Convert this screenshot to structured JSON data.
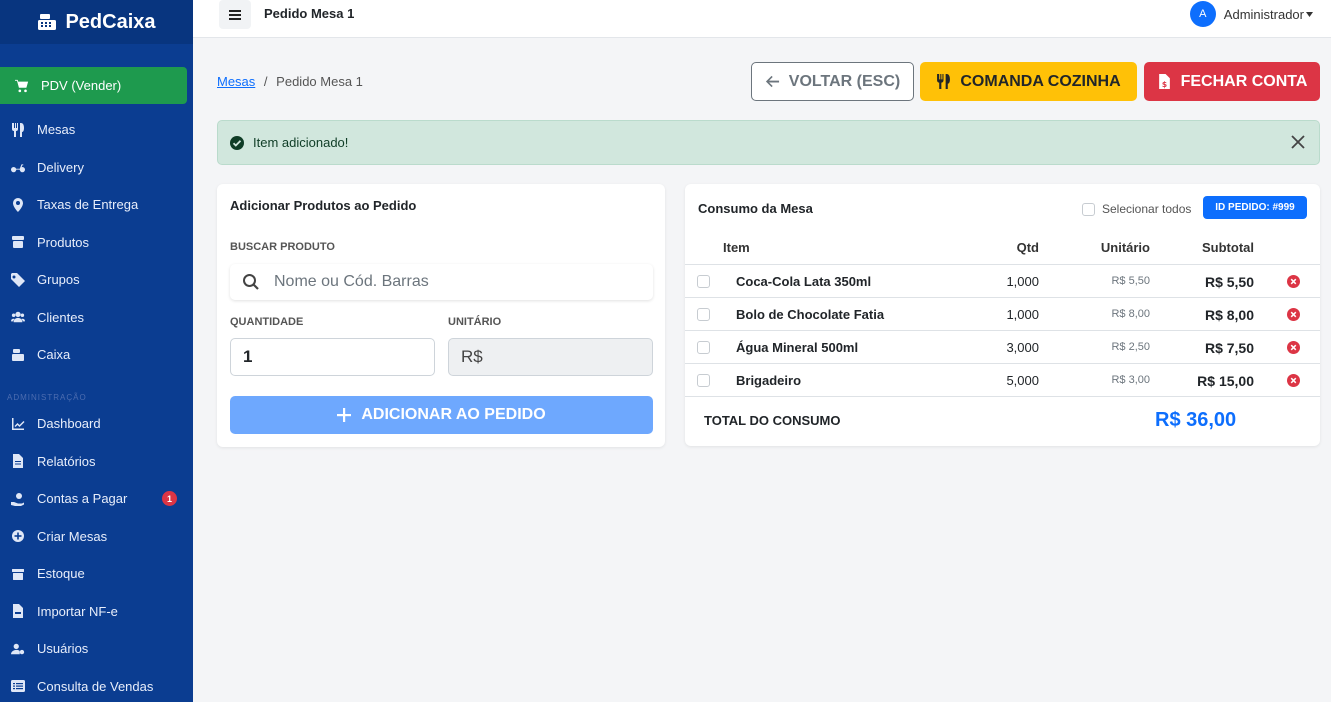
{
  "app": {
    "name": "PedCaixa"
  },
  "sidebar": {
    "pdv_label": "PDV (Vender)",
    "items": [
      {
        "label": "Mesas",
        "icon": "utensils-icon"
      },
      {
        "label": "Delivery",
        "icon": "motorcycle-icon"
      },
      {
        "label": "Taxas de Entrega",
        "icon": "map-pin-icon"
      },
      {
        "label": "Produtos",
        "icon": "box-icon"
      },
      {
        "label": "Grupos",
        "icon": "tag-icon"
      },
      {
        "label": "Clientes",
        "icon": "users-icon"
      },
      {
        "label": "Caixa",
        "icon": "cash-register-icon"
      }
    ],
    "admin_section": "ADMINISTRAÇÃO",
    "admin_items": [
      {
        "label": "Dashboard",
        "icon": "chart-line-icon"
      },
      {
        "label": "Relatórios",
        "icon": "file-icon"
      },
      {
        "label": "Contas a Pagar",
        "icon": "hand-money-icon",
        "badge": "1"
      },
      {
        "label": "Criar Mesas",
        "icon": "plus-circle-icon"
      },
      {
        "label": "Estoque",
        "icon": "warehouse-icon"
      },
      {
        "label": "Importar NF-e",
        "icon": "file-invoice-icon"
      },
      {
        "label": "Usuários",
        "icon": "user-cog-icon"
      },
      {
        "label": "Consulta de Vendas",
        "icon": "list-icon"
      }
    ]
  },
  "topbar": {
    "title": "Pedido Mesa 1",
    "user_initial": "A",
    "user_name": "Administrador"
  },
  "breadcrumb": {
    "link": "Mesas",
    "separator": "/",
    "current": "Pedido Mesa 1"
  },
  "actions": {
    "back": "VOLTAR (ESC)",
    "kitchen": "COMANDA COZINHA",
    "close": "FECHAR CONTA"
  },
  "alert": {
    "message": "Item adicionado!"
  },
  "add_form": {
    "title": "Adicionar Produtos ao Pedido",
    "search_label": "BUSCAR PRODUTO",
    "search_placeholder": "Nome ou Cód. Barras",
    "qty_label": "QUANTIDADE",
    "qty_value": "1",
    "unit_label": "UNITÁRIO",
    "unit_value": "R$",
    "add_button": "ADICIONAR AO PEDIDO"
  },
  "consumo": {
    "title": "Consumo da Mesa",
    "select_all": "Selecionar todos",
    "order_id": "ID PEDIDO: #999",
    "columns": {
      "item": "Item",
      "qtd": "Qtd",
      "unit": "Unitário",
      "subtotal": "Subtotal"
    },
    "rows": [
      {
        "name": "Coca-Cola Lata 350ml",
        "qtd": "1,000",
        "unit": "R$ 5,50",
        "subtotal": "R$ 5,50"
      },
      {
        "name": "Bolo de Chocolate Fatia",
        "qtd": "1,000",
        "unit": "R$ 8,00",
        "subtotal": "R$ 8,00"
      },
      {
        "name": "Água Mineral 500ml",
        "qtd": "3,000",
        "unit": "R$ 2,50",
        "subtotal": "R$ 7,50"
      },
      {
        "name": "Brigadeiro",
        "qtd": "5,000",
        "unit": "R$ 3,00",
        "subtotal": "R$ 15,00"
      }
    ],
    "total_label": "TOTAL DO CONSUMO",
    "total_value": "R$ 36,00"
  },
  "colors": {
    "sidebar": "#0b3d91",
    "pdv": "#1e9a4e",
    "primary": "#0d6efd",
    "warning": "#ffc107",
    "danger": "#dc3545",
    "success_bg": "#d1e7dd"
  }
}
